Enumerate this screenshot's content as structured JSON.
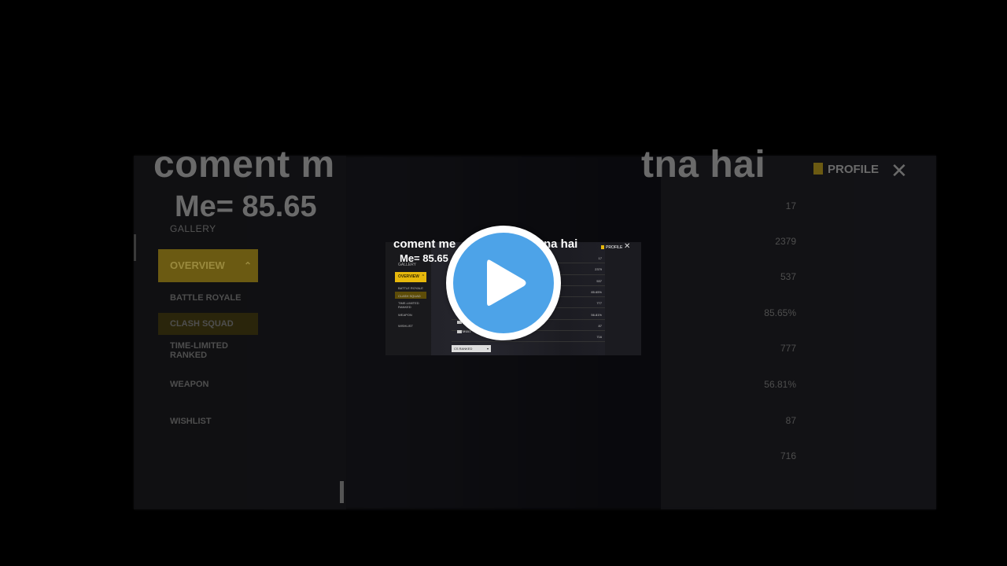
{
  "caption": {
    "line1_left": "coment m",
    "line1_right": "tna hai",
    "line2": "Me= 85.65"
  },
  "thumb_caption": {
    "line1_left": "coment me",
    "line1_right": "tna hai",
    "line2": "Me= 85.65"
  },
  "game_ui": {
    "gallery": "GALLERY",
    "menu": {
      "overview": "OVERVIEW",
      "battle_royale": "BATTLE ROYALE",
      "clash_squad": "CLASH SQUAD",
      "time_limited": "TIME-LIMITED",
      "ranked": "RANKED",
      "weapon": "WEAPON",
      "wishlist": "WISHLIST"
    },
    "profile": "PROFILE",
    "close": "✕",
    "stats": [
      "17",
      "2379",
      "537",
      "85.65%",
      "777",
      "56.81%",
      "87",
      "716"
    ],
    "weapon_label": "M4A1",
    "selector": "CS RANKED"
  },
  "player": {
    "play_icon": "play-icon",
    "accent": "#4da3e8"
  }
}
